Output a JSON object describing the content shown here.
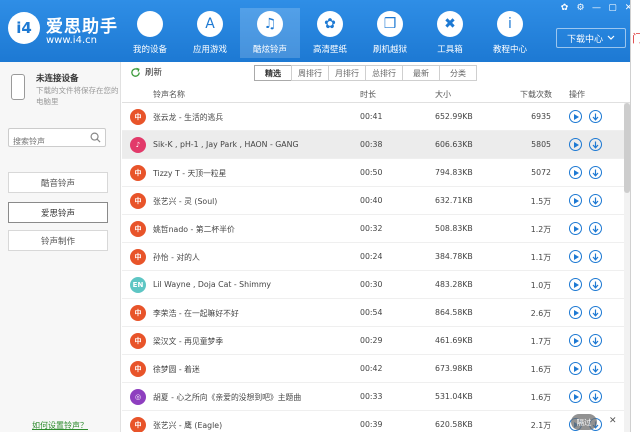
{
  "app": {
    "logo_text": "i4",
    "name": "爱思助手",
    "url": "www.i4.cn"
  },
  "nav": [
    {
      "label": "我的设备",
      "icon": "apple-icon",
      "glyph": ""
    },
    {
      "label": "应用游戏",
      "icon": "app-store-icon",
      "glyph": "A"
    },
    {
      "label": "酷炫铃声",
      "icon": "bell-icon",
      "glyph": "♫",
      "active": true
    },
    {
      "label": "高清壁纸",
      "icon": "flower-icon",
      "glyph": "✿"
    },
    {
      "label": "刷机越狱",
      "icon": "box-icon",
      "glyph": "❒"
    },
    {
      "label": "工具箱",
      "icon": "tools-icon",
      "glyph": "✖"
    },
    {
      "label": "教程中心",
      "icon": "info-icon",
      "glyph": "i"
    }
  ],
  "window_controls": [
    "✿",
    "⚙",
    "—",
    "▢",
    "✕"
  ],
  "download_center": "下载中心",
  "sidebar": {
    "device_title": "未连接设备",
    "device_desc": "下载的文件将保存在您的电脑里",
    "search_placeholder": "搜索铃声",
    "buttons": [
      "酷音铃声",
      "爱思铃声",
      "铃声制作"
    ],
    "active_button": 1,
    "help_link": "如何设置铃声？"
  },
  "toolbar": {
    "refresh": "刷新",
    "tabs": [
      "精选",
      "周排行",
      "月排行",
      "总排行",
      "最新",
      "分类"
    ],
    "active_tab": 0
  },
  "table": {
    "headers": {
      "name": "铃声名称",
      "duration": "时长",
      "size": "大小",
      "downloads": "下载次数",
      "actions": "操作"
    },
    "rows": [
      {
        "name": "张云龙 - 生活的逃兵",
        "duration": "00:41",
        "size": "652.99KB",
        "downloads": "6935",
        "avatar": "中",
        "color": "#e8542a"
      },
      {
        "name": "Sik-K , pH-1 , Jay Park , HAON - GANG",
        "duration": "00:38",
        "size": "606.63KB",
        "downloads": "5805",
        "avatar": "♪",
        "color": "#e23a6a",
        "highlight": true
      },
      {
        "name": "Tizzy T - 天顶一粒星",
        "duration": "00:50",
        "size": "794.83KB",
        "downloads": "5072",
        "avatar": "中",
        "color": "#e8542a"
      },
      {
        "name": "张艺兴 - 灵 (Soul)",
        "duration": "00:40",
        "size": "632.71KB",
        "downloads": "1.5万",
        "avatar": "中",
        "color": "#e8542a"
      },
      {
        "name": "姚哲nado - 第二杯半价",
        "duration": "00:32",
        "size": "508.83KB",
        "downloads": "1.2万",
        "avatar": "中",
        "color": "#e8542a"
      },
      {
        "name": "孙怡 - 对的人",
        "duration": "00:24",
        "size": "384.78KB",
        "downloads": "1.1万",
        "avatar": "中",
        "color": "#e8542a"
      },
      {
        "name": "Lil Wayne , Doja Cat - Shimmy",
        "duration": "00:30",
        "size": "483.28KB",
        "downloads": "1.0万",
        "avatar": "EN",
        "color": "#5ec6c4"
      },
      {
        "name": "李荣浩 - 在一起嘛好不好",
        "duration": "00:54",
        "size": "864.58KB",
        "downloads": "2.6万",
        "avatar": "中",
        "color": "#e8542a"
      },
      {
        "name": "梁汉文 - 再见童梦季",
        "duration": "00:29",
        "size": "461.69KB",
        "downloads": "1.7万",
        "avatar": "中",
        "color": "#e8542a"
      },
      {
        "name": "徐梦圆 - 着迷",
        "duration": "00:42",
        "size": "673.98KB",
        "downloads": "1.6万",
        "avatar": "中",
        "color": "#e8542a"
      },
      {
        "name": "胡夏 - 心之所向《亲爱的没想到吧》主题曲",
        "duration": "00:33",
        "size": "531.04KB",
        "downloads": "1.6万",
        "avatar": "◎",
        "color": "#8e3fbf"
      },
      {
        "name": "张艺兴 - 鹰 (Eagle)",
        "duration": "00:39",
        "size": "620.58KB",
        "downloads": "2.1万",
        "avatar": "中",
        "color": "#e8542a"
      }
    ]
  },
  "float_button": "隔过",
  "float_close": "✕",
  "peek_text": "门"
}
